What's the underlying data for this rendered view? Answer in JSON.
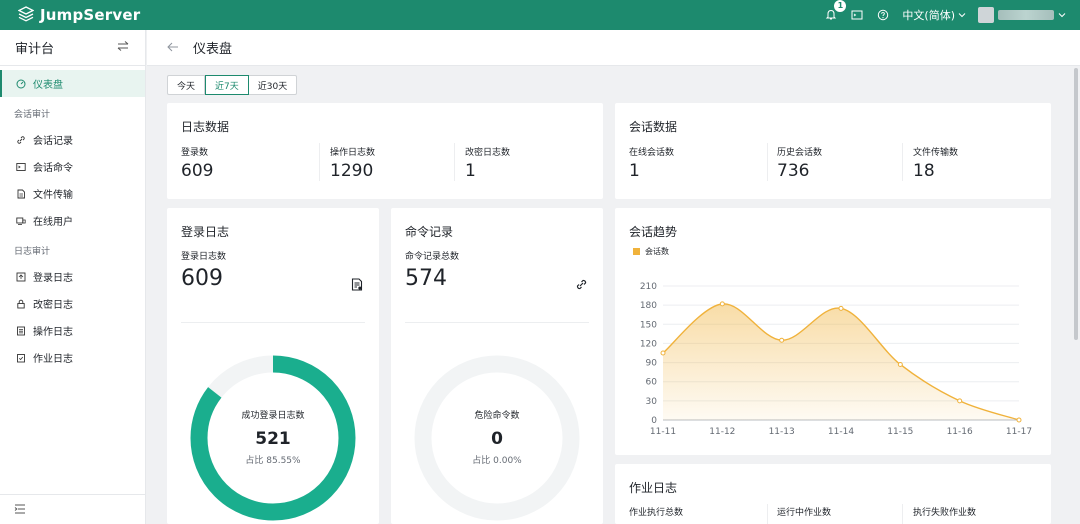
{
  "brand": {
    "name": "JumpServer"
  },
  "topbar": {
    "notifications_count": "1",
    "language": "中文(简体)"
  },
  "sidebar": {
    "title": "审计台",
    "items": [
      {
        "label": "仪表盘",
        "icon": "dashboard-icon",
        "active": true
      }
    ],
    "groups": [
      {
        "label": "会话审计",
        "items": [
          {
            "label": "会话记录",
            "icon": "link-icon"
          },
          {
            "label": "会话命令",
            "icon": "terminal-icon"
          },
          {
            "label": "文件传输",
            "icon": "file-transfer-icon"
          },
          {
            "label": "在线用户",
            "icon": "online-user-icon"
          }
        ]
      },
      {
        "label": "日志审计",
        "items": [
          {
            "label": "登录日志",
            "icon": "login-log-icon"
          },
          {
            "label": "改密日志",
            "icon": "lock-icon"
          },
          {
            "label": "操作日志",
            "icon": "operation-log-icon"
          },
          {
            "label": "作业日志",
            "icon": "job-log-icon"
          }
        ]
      }
    ]
  },
  "page": {
    "title": "仪表盘"
  },
  "tabs": [
    "今天",
    "近7天",
    "近30天"
  ],
  "active_tab": "近7天",
  "log_data": {
    "title": "日志数据",
    "stats": [
      {
        "label": "登录数",
        "value": "609"
      },
      {
        "label": "操作日志数",
        "value": "1290"
      },
      {
        "label": "改密日志数",
        "value": "1"
      }
    ]
  },
  "session_data": {
    "title": "会话数据",
    "stats": [
      {
        "label": "在线会话数",
        "value": "1"
      },
      {
        "label": "历史会话数",
        "value": "736"
      },
      {
        "label": "文件传输数",
        "value": "18"
      }
    ]
  },
  "login_log": {
    "title": "登录日志",
    "label": "登录日志数",
    "value": "609",
    "donut": {
      "label": "成功登录日志数",
      "value": "521",
      "ratio_text": "占比 85.55%",
      "fraction": 0.8555,
      "color": "#1aae8e"
    }
  },
  "command_log": {
    "title": "命令记录",
    "label": "命令记录总数",
    "value": "574",
    "donut": {
      "label": "危险命令数",
      "value": "0",
      "ratio_text": "占比 0.00%",
      "fraction": 0.0,
      "color": "#1aae8e"
    }
  },
  "session_trend": {
    "title": "会话趋势",
    "legend": "会话数"
  },
  "chart_data": {
    "type": "area",
    "x": [
      "11-11",
      "11-12",
      "11-13",
      "11-14",
      "11-15",
      "11-16",
      "11-17"
    ],
    "series": [
      {
        "name": "会话数",
        "values": [
          105,
          182,
          125,
          175,
          87,
          30,
          0
        ]
      }
    ],
    "ylim": [
      0,
      210
    ],
    "yticks": [
      0,
      30,
      60,
      90,
      120,
      150,
      180,
      210
    ],
    "color": "#f0b23b",
    "grid": true,
    "legend_position": "top-left"
  },
  "job_log": {
    "title": "作业日志",
    "stats": [
      {
        "label": "作业执行总数"
      },
      {
        "label": "运行中作业数"
      },
      {
        "label": "执行失败作业数"
      }
    ]
  },
  "colors": {
    "brand": "#1d8a6e",
    "accent": "#1aae8e",
    "chart": "#f0b23b"
  }
}
